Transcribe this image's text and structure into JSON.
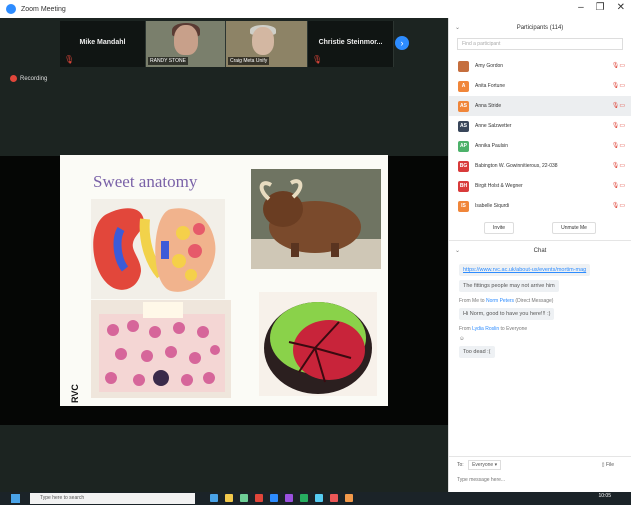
{
  "window": {
    "title": "Zoom Meeting"
  },
  "thumbnails": [
    {
      "name": "Mike Mandahl",
      "video": false
    },
    {
      "name": "",
      "label": "RANDY STONE",
      "video": true
    },
    {
      "name": "",
      "label": "Craig Meta Unify",
      "video": true
    },
    {
      "name": "Christie Steinmor...",
      "video": false
    }
  ],
  "recording": {
    "label": "Recording"
  },
  "slide": {
    "title": "Sweet anatomy",
    "logo": "RVC"
  },
  "participants": {
    "header": "Participants (114)",
    "search_placeholder": "Find a participant",
    "items": [
      {
        "initials": "",
        "name": "Amy Gordon",
        "color": "#c56e3e"
      },
      {
        "initials": "A",
        "name": "Anita Fortune",
        "color": "#f0863a"
      },
      {
        "initials": "AS",
        "name": "Anna Stride",
        "color": "#f0863a"
      },
      {
        "initials": "AS",
        "name": "Anne Salzwetter",
        "color": "#39465a"
      },
      {
        "initials": "AP",
        "name": "Annika Paulsin",
        "color": "#4db26a"
      },
      {
        "initials": "BG",
        "name": "Babington W. Gowinnitierous, 22-038",
        "color": "#d83b3b"
      },
      {
        "initials": "BH",
        "name": "Birgit Holst & Wegner",
        "color": "#d83b3b"
      },
      {
        "initials": "IS",
        "name": "Isabelle Siqurdi",
        "color": "#f0863a"
      }
    ],
    "invite_label": "Invite",
    "unmute_label": "Unmute Me"
  },
  "chat": {
    "header": "Chat",
    "messages": [
      {
        "link": "https://www.rvc.ac.uk/about-us/events/mortim-mag",
        "kind": "link"
      },
      {
        "text": "The fittings people may not arrive him",
        "kind": "bubble"
      },
      {
        "from_prefix": "From Me to",
        "from_who": "Norm Peters",
        "from_suffix": "(Direct Message)",
        "kind": "from"
      },
      {
        "text": "Hi Norm, good to have you here!!! :)",
        "kind": "bubble"
      },
      {
        "from_prefix": "From",
        "from_who": "Lydia Roslin",
        "from_suffix": "to Everyone",
        "kind": "from"
      },
      {
        "text": "☺",
        "kind": "plain"
      },
      {
        "text": "Too dead :(",
        "kind": "bubble"
      }
    ],
    "to_label": "To:",
    "to_value": "Everyone ▾",
    "file_label": "File",
    "input_placeholder": "Type message here..."
  },
  "taskbar": {
    "search_placeholder": "Type here to search",
    "clock": "10:05",
    "icon_colors": [
      "#4aa3e8",
      "#f2c94c",
      "#6fcf97",
      "#e0463a",
      "#2d8cff",
      "#9b51e0",
      "#27ae60",
      "#56ccf2",
      "#eb5757",
      "#f2994a"
    ]
  }
}
